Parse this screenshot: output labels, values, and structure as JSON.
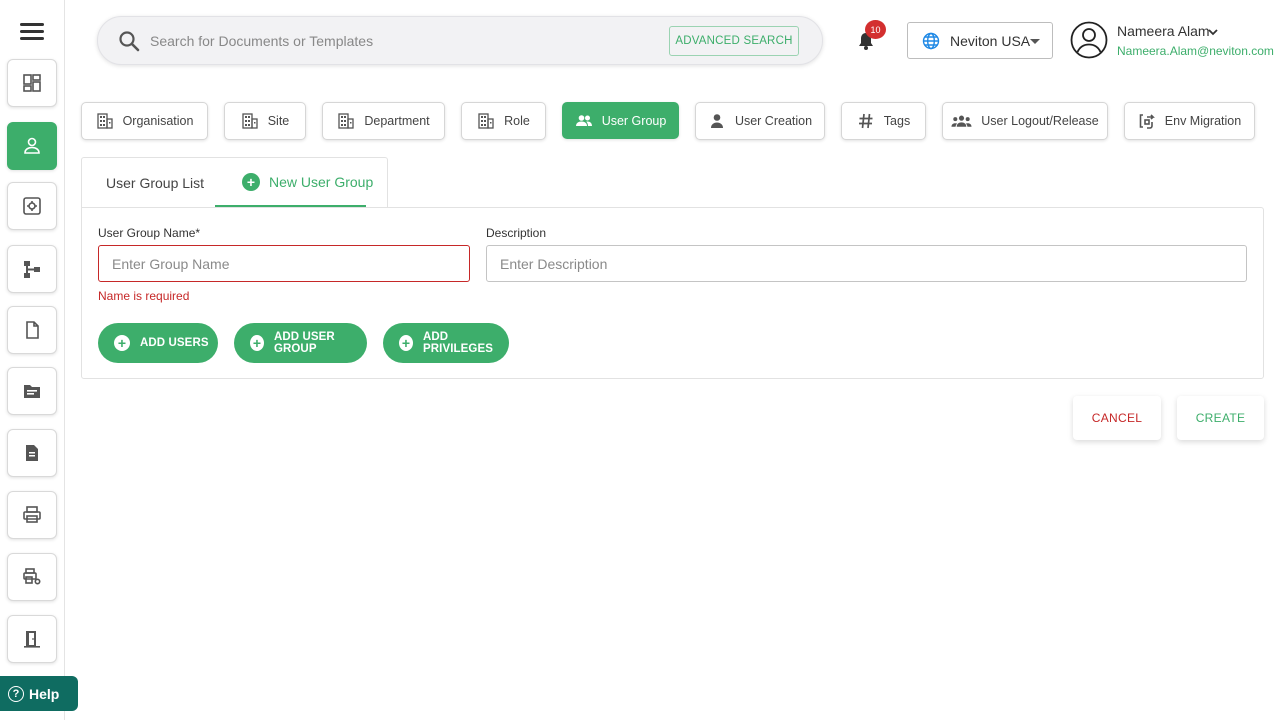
{
  "header": {
    "search": {
      "placeholder": "Search for Documents or Templates",
      "advanced_label": "ADVANCED SEARCH"
    },
    "notifications": {
      "count": "10"
    },
    "org_select": {
      "value": "Neviton USA"
    },
    "user": {
      "name": "Nameera Alam",
      "email": "Nameera.Alam@neviton.com"
    }
  },
  "sidebar": {
    "help_label": "Help",
    "items": [
      {
        "icon": "dashboard-icon"
      },
      {
        "icon": "user-icon",
        "active": true
      },
      {
        "icon": "settings-box-icon"
      },
      {
        "icon": "hierarchy-icon"
      },
      {
        "icon": "document-icon"
      },
      {
        "icon": "folder-icon"
      },
      {
        "icon": "file-text-icon"
      },
      {
        "icon": "printer-icon"
      },
      {
        "icon": "print-settings-icon"
      },
      {
        "icon": "logout-door-icon"
      }
    ]
  },
  "tabs": [
    {
      "label": "Organisation",
      "icon": "building-icon"
    },
    {
      "label": "Site",
      "icon": "building-icon"
    },
    {
      "label": "Department",
      "icon": "building-icon"
    },
    {
      "label": "Role",
      "icon": "building-icon"
    },
    {
      "label": "User Group",
      "icon": "people-icon",
      "active": true
    },
    {
      "label": "User Creation",
      "icon": "person-icon"
    },
    {
      "label": "Tags",
      "icon": "hash-icon"
    },
    {
      "label": "User Logout/Release",
      "icon": "group-icon"
    },
    {
      "label": "Env Migration",
      "icon": "migration-icon"
    }
  ],
  "subtabs": {
    "list_label": "User Group List",
    "new_label": "New User Group"
  },
  "form": {
    "group_name": {
      "label": "User Group Name*",
      "placeholder": "Enter Group Name",
      "value": "",
      "error": "Name is required"
    },
    "description": {
      "label": "Description",
      "placeholder": "Enter Description",
      "value": ""
    },
    "buttons": {
      "add_users": "ADD USERS",
      "add_user_group": "ADD USER GROUP",
      "add_privileges": "ADD PRIVILEGES"
    }
  },
  "actions": {
    "cancel": "CANCEL",
    "create": "CREATE"
  },
  "colors": {
    "accent": "#3dae6b",
    "error": "#c62828",
    "help": "#0f6c61"
  }
}
